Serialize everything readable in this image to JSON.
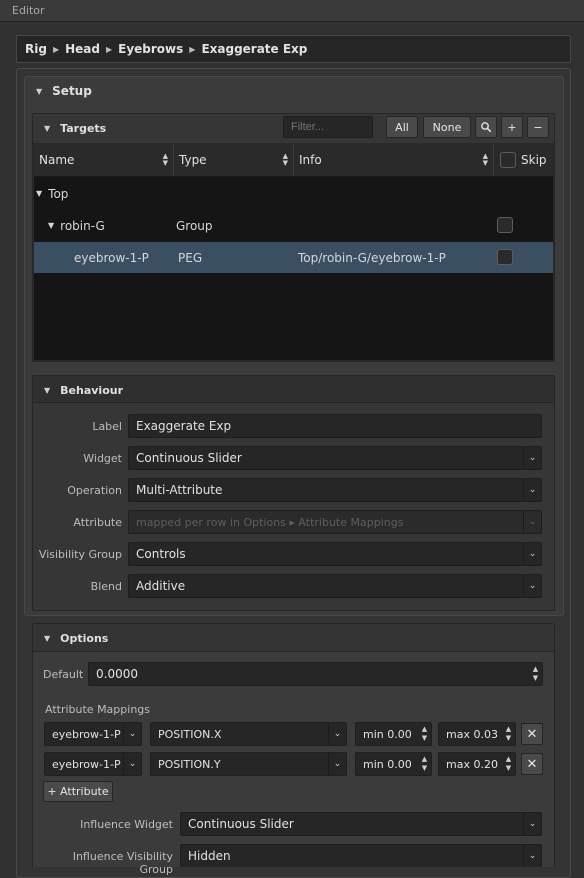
{
  "window": {
    "title": "Editor"
  },
  "breadcrumb": [
    "Rig",
    "Head",
    "Eyebrows",
    "Exaggerate Exp"
  ],
  "setup": {
    "title": "Setup",
    "targets": {
      "title": "Targets",
      "filter_placeholder": "Filter...",
      "all_label": "All",
      "none_label": "None",
      "add_label": "+",
      "remove_label": "−",
      "columns": {
        "name": "Name",
        "type": "Type",
        "info": "Info",
        "skip": "Skip"
      },
      "rows": [
        {
          "name": "Top",
          "type": "",
          "info": ""
        },
        {
          "name": "robin-G",
          "type": "Group",
          "info": ""
        },
        {
          "name": "eyebrow-1-P",
          "type": "PEG",
          "info": "Top/robin-G/eyebrow-1-P"
        }
      ]
    },
    "behaviour": {
      "title": "Behaviour",
      "label_label": "Label",
      "label_value": "Exaggerate Exp",
      "widget_label": "Widget",
      "widget_value": "Continuous Slider",
      "operation_label": "Operation",
      "operation_value": "Multi-Attribute",
      "attribute_label": "Attribute",
      "attribute_placeholder": "mapped per row in Options ▸ Attribute Mappings",
      "visibility_label": "Visibility Group",
      "visibility_value": "Controls",
      "blend_label": "Blend",
      "blend_value": "Additive"
    }
  },
  "options": {
    "title": "Options",
    "default_label": "Default",
    "default_value": "0.0000",
    "mappings_label": "Attribute Mappings",
    "mappings": [
      {
        "node": "eyebrow-1-P",
        "attribute": "POSITION.X",
        "min": "min 0.00",
        "max": "max 0.03"
      },
      {
        "node": "eyebrow-1-P",
        "attribute": "POSITION.Y",
        "min": "min 0.00",
        "max": "max 0.20"
      }
    ],
    "add_attribute_label": "+ Attribute",
    "influence_widget_label": "Influence Widget",
    "influence_widget_value": "Continuous Slider",
    "influence_visibility_label": "Influence Visibility Group",
    "influence_visibility_value": "Hidden"
  }
}
